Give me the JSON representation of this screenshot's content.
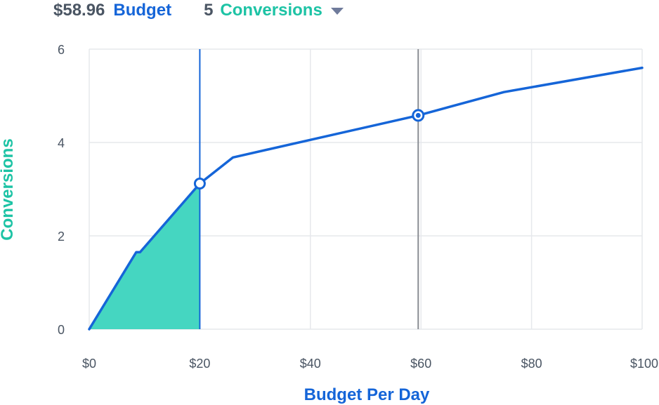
{
  "header": {
    "budget_value": "$58.96",
    "budget_label": "Budget",
    "conversions_value": "5",
    "conversions_label": "Conversions"
  },
  "colors": {
    "accent_blue": "#1565d8",
    "accent_teal": "#1dc3a5",
    "fill_teal": "#45d6c1",
    "text_gray": "#4a5563",
    "grid": "#e6e8ec",
    "marker_gray": "#8a8d93"
  },
  "icons": {
    "dropdown": "chevron-down-icon"
  },
  "chart_data": {
    "type": "line",
    "xlabel": "Budget Per Day",
    "ylabel": "Conversions",
    "xlim": [
      0,
      100
    ],
    "ylim": [
      0,
      6
    ],
    "x_ticks": [
      0,
      20,
      40,
      60,
      80,
      100
    ],
    "x_tick_labels": [
      "$0",
      "$20",
      "$40",
      "$60",
      "$80",
      "$100"
    ],
    "y_ticks": [
      0,
      2,
      4,
      6
    ],
    "y_tick_labels": [
      "0",
      "2",
      "4",
      "6"
    ],
    "grid": true,
    "series": [
      {
        "points": [
          [
            0,
            0
          ],
          [
            8.5,
            1.65
          ],
          [
            9.2,
            1.65
          ],
          [
            20,
            3.12
          ],
          [
            26,
            3.68
          ],
          [
            59.5,
            4.58
          ],
          [
            75,
            5.08
          ],
          [
            100,
            5.6
          ]
        ]
      }
    ],
    "shaded_area": {
      "x_from": 0,
      "x_to": 20
    },
    "markers": [
      {
        "x": 20,
        "y": 3.12,
        "style": "hollow",
        "line_color": "blue"
      },
      {
        "x": 59.5,
        "y": 4.58,
        "style": "filled",
        "line_color": "gray"
      }
    ]
  }
}
